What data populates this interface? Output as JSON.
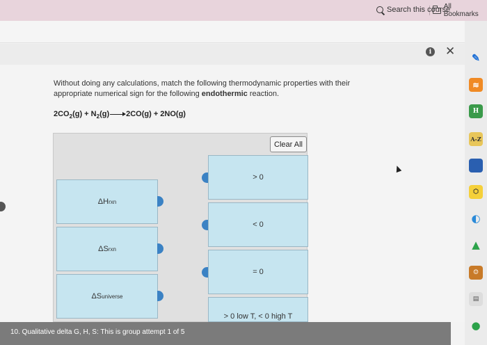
{
  "browser": {
    "all_bookmarks_label": "All Bookmarks"
  },
  "course": {
    "search_placeholder": "Search this course"
  },
  "question": {
    "instructions_prefix": "Without doing any calculations, match the following thermodynamic properties with their appropriate numerical sign for the following ",
    "instructions_bold": "endothermic",
    "instructions_suffix": " reaction.",
    "equation": {
      "reactant1": "2CO",
      "reactant1_sub": "2",
      "reactant1_state": "(g) + N",
      "reactant2_sub": "2",
      "reactant2_state": "(g)",
      "products": "2CO(g) + 2NO(g)"
    },
    "clear_all_label": "Clear All",
    "properties": [
      {
        "symbol": "ΔH",
        "sub": "rxn"
      },
      {
        "symbol": "ΔS",
        "sub": "rxn"
      },
      {
        "symbol": "ΔS",
        "sub": "universe"
      }
    ],
    "values": [
      "> 0",
      "< 0",
      "= 0",
      "> 0 low T, < 0 high T"
    ]
  },
  "footer": {
    "attempt_text": "10. Qualitative delta G, H, S: This is group attempt 1 of 5"
  },
  "extensions": [
    "pen",
    "rss",
    "H",
    "A-Z",
    "book",
    "hex",
    "drop",
    "drive",
    "person",
    "note",
    "circle"
  ]
}
